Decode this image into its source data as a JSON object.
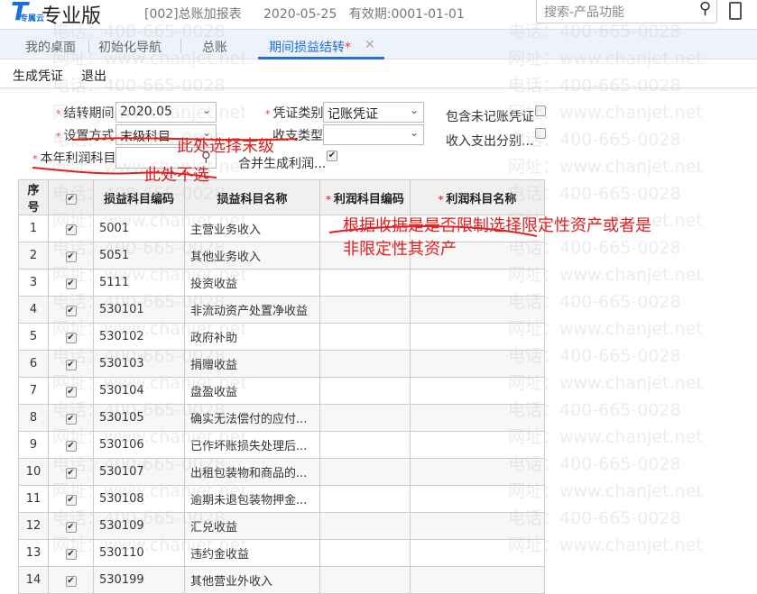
{
  "header": {
    "logo_sub": "专属云",
    "edition": "专业版",
    "account": "[002]总账加报表",
    "date": "2020-05-25",
    "validity": "有效期:0001-01-01",
    "search_placeholder": "搜索-产品功能"
  },
  "tabs": [
    {
      "label": "我的桌面"
    },
    {
      "label": "初始化导航"
    },
    {
      "label": "总账"
    },
    {
      "label": "期间损益结转",
      "modified": "*",
      "close": "✕"
    }
  ],
  "toolbar": {
    "generate": "生成凭证",
    "exit": "退出"
  },
  "form": {
    "period_label": "结转期间",
    "period_value": "2020.05",
    "voucher_type_label": "凭证类别",
    "voucher_type_value": "记账凭证",
    "include_unposted_label": "包含未记账凭证",
    "setting_label": "设置方式",
    "setting_value": "末级科目",
    "income_type_label": "收支类型",
    "income_type_value": "",
    "separate_label": "收入支出分别...",
    "profit_account_label": "本年利润科目",
    "profit_account_value": "",
    "merge_label": "合并生成利润..."
  },
  "table": {
    "headers": [
      "序号",
      "",
      "损益科目编码",
      "损益科目名称",
      "利润科目编码",
      "利润科目名称"
    ],
    "rows": [
      [
        "1",
        "5001",
        "主营业务收入"
      ],
      [
        "2",
        "5051",
        "其他业务收入"
      ],
      [
        "3",
        "5111",
        "投资收益"
      ],
      [
        "4",
        "530101",
        "非流动资产处置净收益"
      ],
      [
        "5",
        "530102",
        "政府补助"
      ],
      [
        "6",
        "530103",
        "捐赠收益"
      ],
      [
        "7",
        "530104",
        "盘盈收益"
      ],
      [
        "8",
        "530105",
        "确实无法偿付的应付..."
      ],
      [
        "9",
        "530106",
        "已作坏账损失处理后..."
      ],
      [
        "10",
        "530107",
        "出租包装物和商品的..."
      ],
      [
        "11",
        "530108",
        "逾期未退包装物押金..."
      ],
      [
        "12",
        "530109",
        "汇兑收益"
      ],
      [
        "13",
        "530110",
        "违约金收益"
      ],
      [
        "14",
        "530199",
        "其他营业外收入"
      ]
    ]
  },
  "annotations": {
    "a1": "此处选择末级",
    "a2": "此处不选",
    "a3_line1": "根据收据是是否限制选择限定性资产或者是",
    "a3_line2": "非限定性其资产"
  },
  "watermark": {
    "phone": "电话：400-665-0028",
    "site": "网址：www.chanjet.net"
  }
}
